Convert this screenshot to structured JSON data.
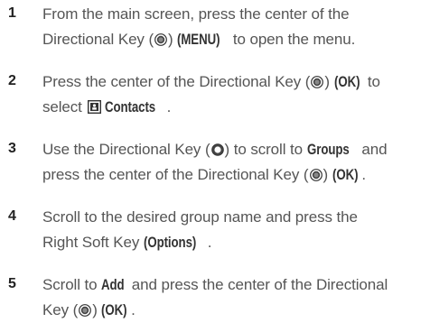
{
  "steps": [
    {
      "number": "1",
      "t1": "From the main screen, press the center of the",
      "t2": "Directional Key (",
      "t3": ") ",
      "b1": "(MENU)",
      "t4": " to open the menu."
    },
    {
      "number": "2",
      "t1": "Press the center of the Directional Key (",
      "t2": ") ",
      "b1": "(OK)",
      "t3": " to",
      "t4": "select ",
      "b2": "Contacts",
      "t5": "."
    },
    {
      "number": "3",
      "t1": "Use the Directional Key (",
      "t2": ") to scroll to ",
      "b1": "Groups",
      "t3": " and",
      "t4": "press the center of the Directional Key (",
      "t5": ") ",
      "b2": "(OK)",
      "t6": "."
    },
    {
      "number": "4",
      "t1": "Scroll to the desired group name and press the",
      "t2": "Right Soft Key ",
      "b1": "(Options)",
      "t3": "."
    },
    {
      "number": "5",
      "t1": "Scroll to ",
      "b1": "Add",
      "t2": " and press the center of the Directional",
      "t3": "Key (",
      "t4": ") ",
      "b2": "(OK)",
      "t5": "."
    }
  ],
  "icons": {
    "key_center": "directional-key-center-icon",
    "key_ring": "directional-key-icon",
    "contacts": "contacts-icon"
  },
  "colors": {
    "text": "#555555",
    "number": "#222222",
    "bold": "#333333"
  }
}
